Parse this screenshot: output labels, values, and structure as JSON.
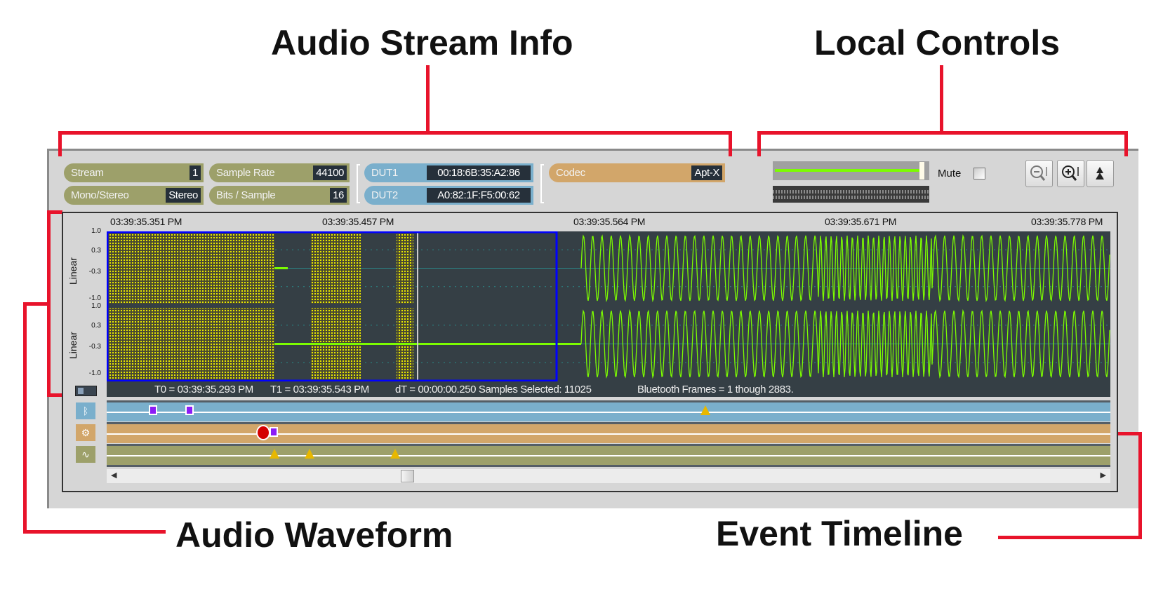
{
  "callouts": {
    "stream_info": "Audio Stream Info",
    "local_controls": "Local Controls",
    "waveform": "Audio Waveform",
    "timeline": "Event Timeline"
  },
  "stream_info": {
    "stream": {
      "label": "Stream",
      "value": "1"
    },
    "mono_stereo": {
      "label": "Mono/Stereo",
      "value": "Stereo"
    },
    "sample_rate": {
      "label": "Sample Rate",
      "value": "44100"
    },
    "bits_sample": {
      "label": "Bits / Sample",
      "value": "16"
    },
    "dut1": {
      "label": "DUT1",
      "value": "00:18:6B:35:A2:86"
    },
    "dut2": {
      "label": "DUT2",
      "value": "A0:82:1F:F5:00:62"
    },
    "codec": {
      "label": "Codec",
      "value": "Apt-X"
    }
  },
  "local_controls": {
    "volume_level": 0.97,
    "mute_label": "Mute",
    "mute_checked": false,
    "buttons": [
      {
        "icon": "zoom-out-vertical-icon"
      },
      {
        "icon": "zoom-in-vertical-icon"
      },
      {
        "icon": "jump-up-icon"
      }
    ]
  },
  "waveform": {
    "time_labels": [
      "03:39:35.351 PM",
      "03:39:35.457 PM",
      "03:39:35.564 PM",
      "03:39:35.671 PM",
      "03:39:35.778 PM"
    ],
    "y_ticks": [
      "1.0",
      "0.3",
      "-0.3",
      "-1.0"
    ],
    "scale_label": "Linear",
    "status": {
      "t0": "T0 = 03:39:35.293 PM",
      "t1": "T1 = 03:39:35.543 PM",
      "dt": "dT = 00:00:00.250 Samples Selected: 11025",
      "frames": "Bluetooth Frames = 1 though 2883."
    },
    "colors": {
      "wave": "#7cfc00",
      "background": "#353f45",
      "selection": "#0000ff",
      "gap": "#e8e800"
    }
  },
  "timeline": {
    "lanes": [
      {
        "icon": "bluetooth-icon",
        "color": "#7aafcc"
      },
      {
        "icon": "gears-icon",
        "color": "#d2a66a"
      },
      {
        "icon": "waveform-icon",
        "color": "#9da06a"
      }
    ]
  }
}
